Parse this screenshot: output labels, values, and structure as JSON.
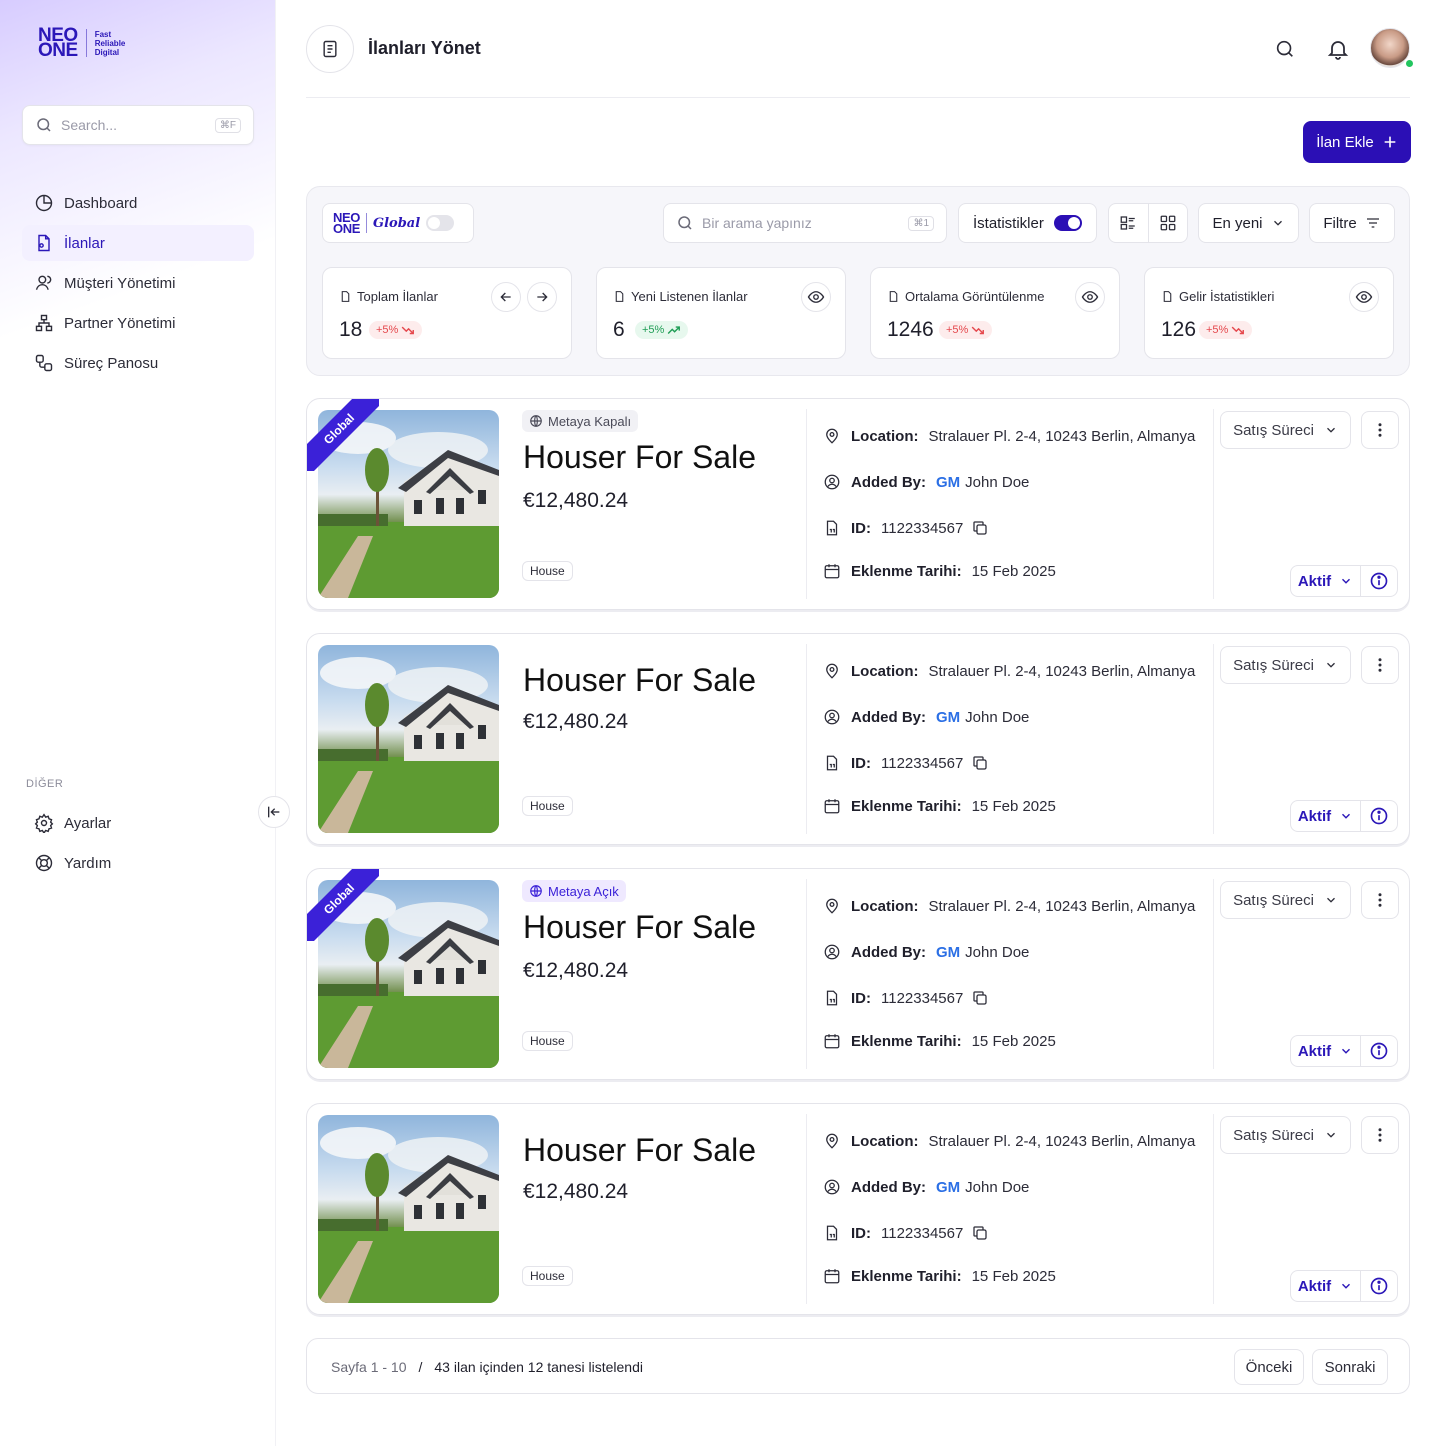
{
  "brand": {
    "logo_line1": "NEO",
    "logo_line2": "ONE",
    "tagline": [
      "Fast",
      "Reliable",
      "Digital"
    ]
  },
  "sidebar": {
    "search_placeholder": "Search...",
    "search_shortcut": "⌘F",
    "nav": [
      {
        "label": "Dashboard",
        "icon": "pie-chart-icon"
      },
      {
        "label": "İlanlar",
        "icon": "document-icon",
        "active": true
      },
      {
        "label": "Müşteri Yönetimi",
        "icon": "users-icon"
      },
      {
        "label": "Partner Yönetimi",
        "icon": "hierarchy-icon"
      },
      {
        "label": "Süreç Panosu",
        "icon": "workflow-icon"
      }
    ],
    "section_other": "DİĞER",
    "other": [
      {
        "label": "Ayarlar",
        "icon": "gear-icon"
      },
      {
        "label": "Yardım",
        "icon": "lifebuoy-icon"
      }
    ]
  },
  "header": {
    "title": "İlanları Yönet"
  },
  "add_button": "İlan Ekle",
  "toolbar": {
    "global_label": "Global",
    "global_enabled": false,
    "search_placeholder": "Bir arama yapınız",
    "search_shortcut": "⌘1",
    "stats_label": "İstatistikler",
    "stats_enabled": true,
    "sort_label": "En yeni",
    "filter_label": "Filtre"
  },
  "stats": [
    {
      "label": "Toplam İlanlar",
      "value": "18",
      "change": "+5%",
      "trend": "down"
    },
    {
      "label": "Yeni Listenen İlanlar",
      "value": "6",
      "change": "+5%",
      "trend": "up"
    },
    {
      "label": "Ortalama Görüntülenme",
      "value": "1246",
      "change": "+5%",
      "trend": "down"
    },
    {
      "label": "Gelir İstatistikleri",
      "value": "126",
      "change": "+5%",
      "trend": "down"
    }
  ],
  "labels": {
    "location": "Location:",
    "added_by": "Added By:",
    "id": "ID:",
    "date": "Eklenme Tarihi:",
    "ribbon": "Global"
  },
  "listings": [
    {
      "ribbon": true,
      "visibility": "Metaya Kapalı",
      "visibility_state": "closed",
      "title": "Houser For Sale",
      "price": "€12,480.24",
      "type": "House",
      "location": "Stralauer Pl. 2-4, 10243 Berlin, Almanya",
      "added_by_initials": "GM",
      "added_by": "John Doe",
      "id": "1122334567",
      "date": "15 Feb 2025",
      "process": "Satış Süreci",
      "status": "Aktif"
    },
    {
      "ribbon": false,
      "visibility": "",
      "visibility_state": "none",
      "title": "Houser For Sale",
      "price": "€12,480.24",
      "type": "House",
      "location": "Stralauer Pl. 2-4, 10243 Berlin, Almanya",
      "added_by_initials": "GM",
      "added_by": "John Doe",
      "id": "1122334567",
      "date": "15 Feb 2025",
      "process": "Satış Süreci",
      "status": "Aktif"
    },
    {
      "ribbon": true,
      "visibility": "Metaya Açık",
      "visibility_state": "open",
      "title": "Houser For Sale",
      "price": "€12,480.24",
      "type": "House",
      "location": "Stralauer Pl. 2-4, 10243 Berlin, Almanya",
      "added_by_initials": "GM",
      "added_by": "John Doe",
      "id": "1122334567",
      "date": "15 Feb 2025",
      "process": "Satış Süreci",
      "status": "Aktif"
    },
    {
      "ribbon": false,
      "visibility": "",
      "visibility_state": "none",
      "title": "Houser For Sale",
      "price": "€12,480.24",
      "type": "House",
      "location": "Stralauer Pl. 2-4, 10243 Berlin, Almanya",
      "added_by_initials": "GM",
      "added_by": "John Doe",
      "id": "1122334567",
      "date": "15 Feb 2025",
      "process": "Satış Süreci",
      "status": "Aktif"
    }
  ],
  "pagination": {
    "range": "Sayfa 1 - 10",
    "separator": "/",
    "summary": "43 ilan içinden 12 tanesi listelendi",
    "prev": "Önceki",
    "next": "Sonraki"
  },
  "colors": {
    "brand": "#2b0fb5",
    "accent_blue": "#2b6fe5",
    "trend_down": "#e5484d",
    "trend_up": "#1f9d55",
    "online": "#22c55e"
  }
}
